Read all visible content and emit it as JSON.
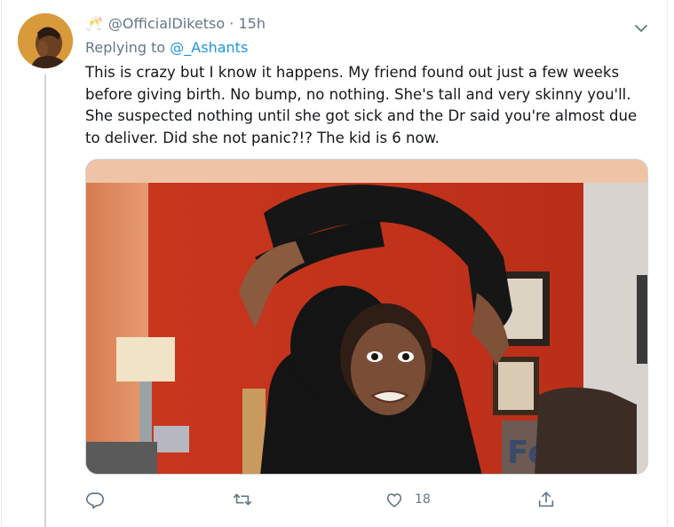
{
  "tweet": {
    "emoji": "🥂",
    "handle": "@OfficialDiketso",
    "separator": "·",
    "time": "15h",
    "replying_prefix": "Replying to",
    "replying_to": "@_Ashants",
    "text": "This is crazy but I know it happens. My friend found out just a few weeks\nbefore giving birth. No bump, no nothing. She's tall and very skinny you'll.\nShe suspected nothing until she got sick and the Dr said you're almost due\nto deliver. Did she not panic?!? The kid is 6 now.",
    "media_sign_text": "Fe",
    "likes": "18"
  },
  "icons": {
    "menu": "chevron-down-icon",
    "reply": "reply-icon",
    "retweet": "retweet-icon",
    "like": "heart-icon",
    "share": "share-icon"
  },
  "colors": {
    "text": "#14171a",
    "secondary": "#657786",
    "link": "#1b95e0",
    "thread_line": "#ccd6dd"
  }
}
